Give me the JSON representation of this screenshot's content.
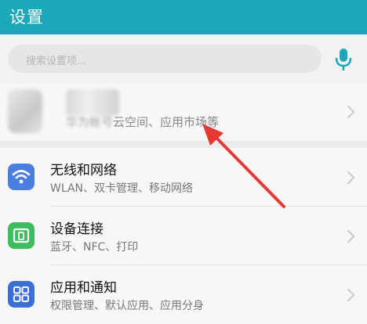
{
  "header": {
    "title": "设置"
  },
  "search": {
    "placeholder": "搜索设置项..."
  },
  "account": {
    "subtitle_visible": "云空间、应用市场等",
    "subtitle_blurred": "华为帐号"
  },
  "items": [
    {
      "title": "无线和网络",
      "subtitle": "WLAN、双卡管理、移动网络",
      "icon": "wifi-icon",
      "color": "#4a7fe0"
    },
    {
      "title": "设备连接",
      "subtitle": "蓝牙、NFC、打印",
      "icon": "device-connect-icon",
      "color": "#3dbd5f"
    },
    {
      "title": "应用和通知",
      "subtitle": "权限管理、默认应用、应用分身",
      "icon": "apps-icon",
      "color": "#3b6fd6"
    }
  ],
  "colors": {
    "header": "#1ba8b9",
    "annotation_arrow": "#e53935"
  }
}
